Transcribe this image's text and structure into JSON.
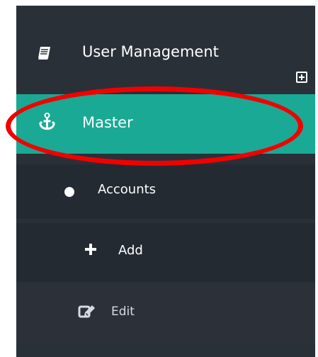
{
  "menu": {
    "user_management": {
      "label": "User Management",
      "icon": "book-icon",
      "action_icon": "plus-square-icon"
    },
    "master": {
      "label": "Master",
      "icon": "anchor-icon"
    },
    "accounts": {
      "label": "Accounts",
      "icon": "dot-icon"
    },
    "add": {
      "label": "Add",
      "icon": "plus-icon"
    },
    "edit": {
      "label": "Edit",
      "icon": "edit-icon"
    }
  },
  "colors": {
    "sidebar_background": "#2a3038",
    "submenu_background": "#232a31",
    "active_background": "#1aa995",
    "highlight": "#f20000",
    "text": "#ffffff"
  }
}
